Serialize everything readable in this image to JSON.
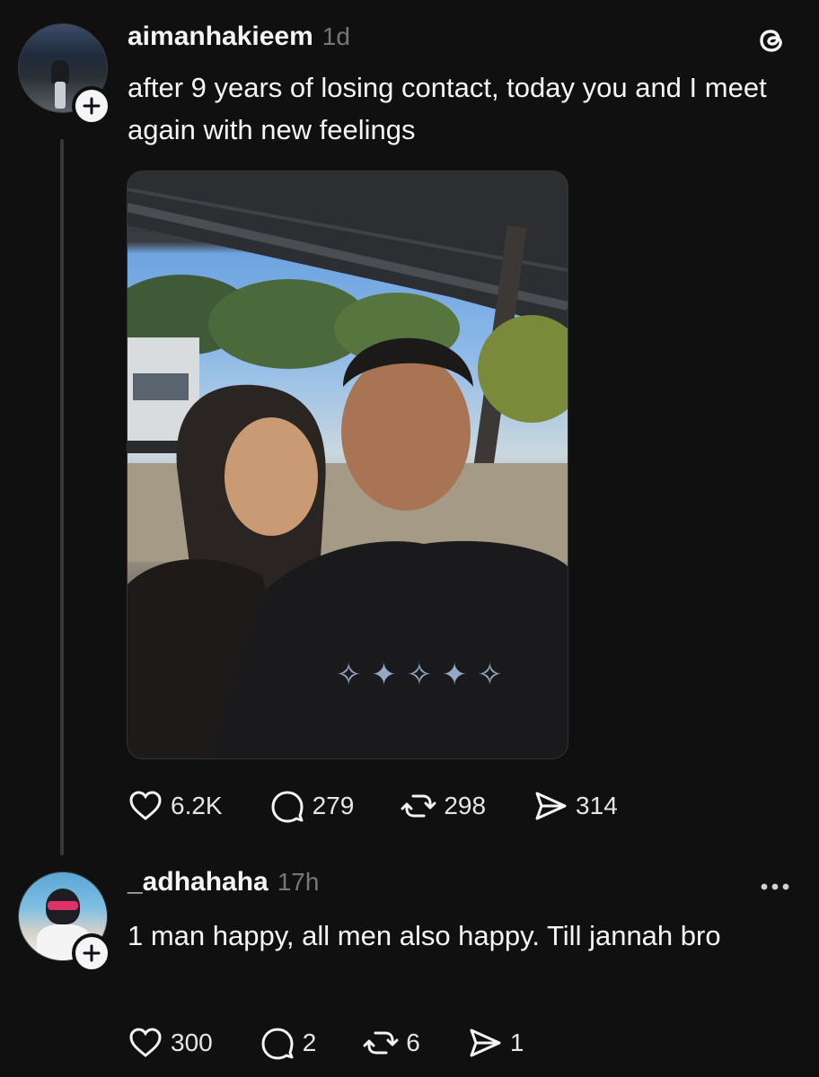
{
  "posts": [
    {
      "username": "aimanhakieem",
      "time": "1d",
      "text": "after 9 years of losing contact, today you and I meet again with new feelings",
      "likes": "6.2K",
      "replies": "279",
      "reposts": "298",
      "shares": "314"
    },
    {
      "username": "_adhahaha",
      "time": "17h",
      "text": "1 man happy, all men also happy. Till jannah bro",
      "likes": "300",
      "replies": "2",
      "reposts": "6",
      "shares": "1"
    }
  ],
  "icons": {
    "app_logo": "threads-logo-icon",
    "like": "heart-icon",
    "reply": "comment-icon",
    "repost": "repost-icon",
    "share": "send-icon",
    "follow": "plus-icon",
    "menu": "more-icon"
  },
  "colors": {
    "background": "#101010",
    "text": "#f3f5f7",
    "muted": "#777777",
    "thread_line": "#383838"
  }
}
